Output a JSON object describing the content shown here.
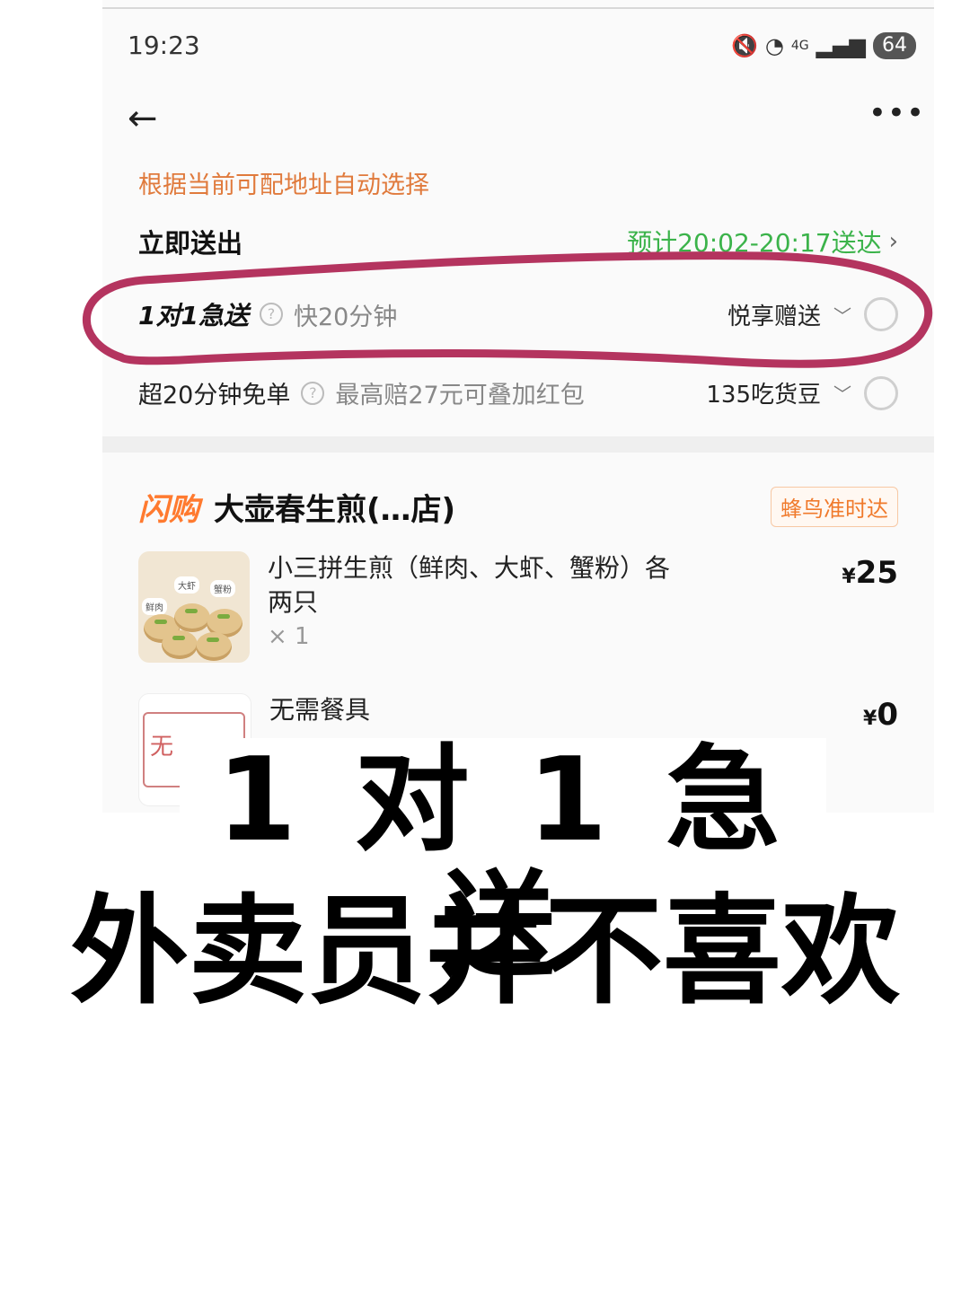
{
  "status_bar": {
    "time": "19:23",
    "network": "4G",
    "battery": "64"
  },
  "nav": {
    "back_icon": "arrow-left-icon",
    "more_icon": "more-dots-icon"
  },
  "address_hint": "根据当前可配地址自动选择",
  "delivery": {
    "now_label": "立即送出",
    "eta": "预计20:02-20:17送达"
  },
  "options": [
    {
      "title": "1对1急送",
      "desc": "快20分钟",
      "right_label": "悦享赠送"
    },
    {
      "title": "超20分钟免单",
      "desc": "最高赔27元可叠加红包",
      "right_label": "135吃货豆"
    }
  ],
  "shop": {
    "badge": "闪购",
    "name": "大壶春生煎(…店)",
    "tag": "蜂鸟准时达"
  },
  "items": [
    {
      "name": "小三拼生煎（鲜肉、大虾、蟹粉）各两只",
      "qty": "× 1",
      "price": "25"
    },
    {
      "name": "无需餐具",
      "price": "0",
      "thumb_text": "无"
    }
  ],
  "thumb_labels": {
    "a": "大虾",
    "b": "蟹粉",
    "c": "鲜肉"
  },
  "overlay": {
    "line1": "1 对 1 急送",
    "line2": "外卖员并不喜欢"
  },
  "colors": {
    "accent_orange": "#e07a3c",
    "eta_green": "#3bb34a",
    "annotation": "#b4345f"
  }
}
